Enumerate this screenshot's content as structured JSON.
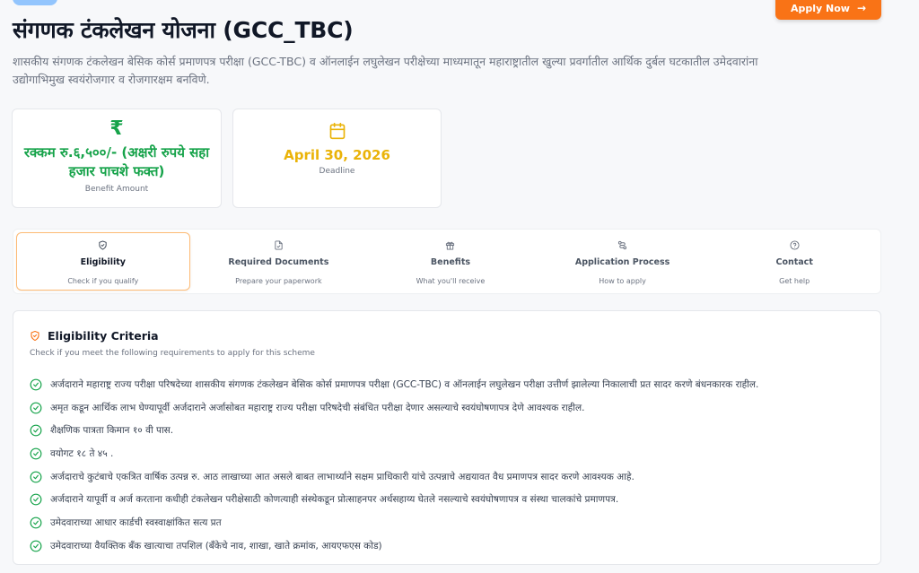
{
  "header": {
    "apply_label": "Apply Now",
    "apply_arrow": "→",
    "title": "संगणक टंकलेखन योजना (GCC_TBC)",
    "description": "शासकीय संगणक टंकलेखन बेसिक कोर्स प्रमाणपत्र परीक्षा (GCC-TBC) व ऑनलाईन लघुलेखन परीक्षेच्या माध्यमातून महाराष्ट्रातील खुल्या प्रवर्गातील आर्थिक दुर्बल घटकातील उमेदवारांना उद्योगाभिमुख स्वयंरोजगार व रोजगारक्षम बनविणे."
  },
  "cards": {
    "benefit": {
      "symbol": "₹",
      "value": "रक्कम रु.६,५००/- (अक्षरी रुपये सहा हजार पाचशे फक्त)",
      "label": "Benefit Amount"
    },
    "deadline": {
      "value": "April 30, 2026",
      "label": "Deadline"
    }
  },
  "tabs": [
    {
      "title": "Eligibility",
      "sub": "Check if you qualify"
    },
    {
      "title": "Required Documents",
      "sub": "Prepare your paperwork"
    },
    {
      "title": "Benefits",
      "sub": "What you'll receive"
    },
    {
      "title": "Application Process",
      "sub": "How to apply"
    },
    {
      "title": "Contact",
      "sub": "Get help"
    }
  ],
  "eligibility": {
    "title": "Eligibility Criteria",
    "subtitle": "Check if you meet the following requirements to apply for this scheme",
    "items": [
      "अर्जदाराने महाराष्ट्र राज्य परीक्षा परिषदेच्या शासकीय संगणक टंकलेखन बेसिक कोर्स प्रमाणपत्र परीक्षा (GCC-TBC) व ऑनलाईन लघुलेखन परीक्षा उत्तीर्ण झालेल्या निकालाची प्रत सादर करणे बंधनकारक राहील.",
      "अमृत कडून आर्थिक लाभ घेण्यापूर्वी अर्जदाराने अर्जासोबत महाराष्ट्र राज्य परीक्षा परिषदेची संबंधित परीक्षा देणार असल्याचे स्वयंघोषणापत्र देणे आवश्यक राहील.",
      "शैक्षणिक पात्रता किमान १० वी पास.",
      "वयोगट १८ ते ४५ .",
      "अर्जदाराचे कुटंबाचे एकत्रित वार्षिक उत्पन्न रु. आठ लाखाच्या आत असले बाबत लाभार्थ्याने सक्षम प्राधिकारी यांचे उत्पन्नाचे अद्ययावत वैध प्रमाणपत्र सादर करणे आवश्यक आहे.",
      "अर्जदाराने यापूर्वी व अर्ज करताना कधीही टंकलेखन परीक्षेसाठी कोणत्याही संस्थेकडून प्रोत्साहनपर अर्थसहाय्य घेतले नसल्याचे स्वयंघोषणापत्र व संस्था चालकांचे प्रमाणपत्र.",
      "उमेदवाराच्या आधार कार्डची स्वस्वाक्षांकित सत्य प्रत",
      "उमेदवाराच्या वैयक्तिक बँक खात्याचा तपशिल (बँकेचे नाव, शाखा, खाते क्रमांक, आयएफएस कोड)"
    ]
  },
  "icons": {
    "apply": "arrow-right-icon",
    "benefit": "rupee-icon",
    "deadline": "calendar-icon",
    "tab_eligibility": "shield-check-icon",
    "tab_documents": "file-icon",
    "tab_benefits": "gift-icon",
    "tab_process": "route-icon",
    "tab_contact": "help-circle-icon",
    "criteria_heading": "shield-icon",
    "criteria_item": "check-circle-icon"
  },
  "colors": {
    "accent": "#f97316",
    "benefit": "#16a34a",
    "deadline": "#eab308",
    "check": "#16a34a"
  }
}
